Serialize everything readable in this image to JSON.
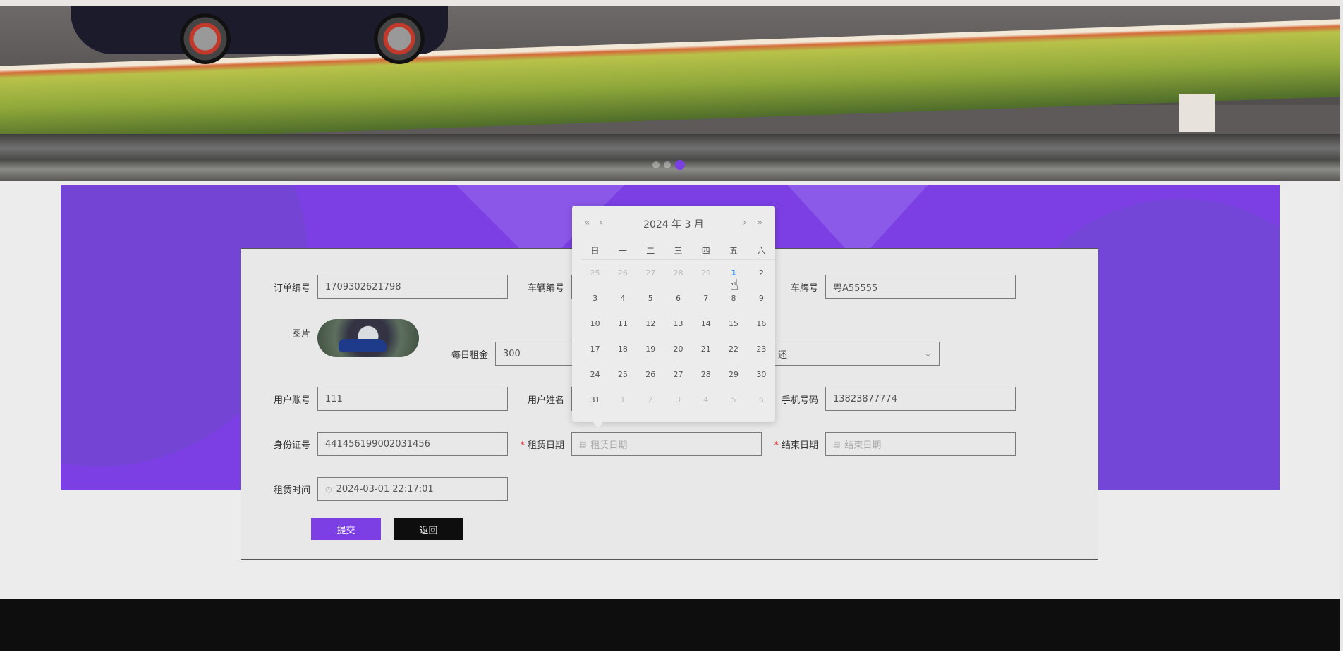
{
  "carousel": {
    "slide_count": 3,
    "active_index": 2
  },
  "form": {
    "order_no": {
      "label": "订单编号",
      "value": "1709302621798"
    },
    "vehicle_no": {
      "label": "车辆编号"
    },
    "plate": {
      "label": "车牌号",
      "value": "粤A55555"
    },
    "picture": {
      "label": "图片"
    },
    "daily_rent": {
      "label": "每日租金",
      "value": "300"
    },
    "status_select": {
      "value": "还"
    },
    "user_account": {
      "label": "用户账号",
      "value": "111"
    },
    "user_name": {
      "label": "用户姓名"
    },
    "phone": {
      "label": "手机号码",
      "value": "13823877774"
    },
    "id_card": {
      "label": "身份证号",
      "value": "441456199002031456"
    },
    "rent_date": {
      "label": "租赁日期",
      "placeholder": "租赁日期",
      "required_mark": "*"
    },
    "end_date": {
      "label": "结束日期",
      "placeholder": "结束日期",
      "required_mark": "*"
    },
    "rent_time": {
      "label": "租赁时间",
      "value": "2024-03-01 22:17:01"
    },
    "submit_label": "提交",
    "back_label": "返回"
  },
  "calendar": {
    "title": "2024 年  3 月",
    "nav": {
      "prev_year": "«",
      "prev_month": "‹",
      "next_month": "›",
      "next_year": "»"
    },
    "weekdays": [
      "日",
      "一",
      "二",
      "三",
      "四",
      "五",
      "六"
    ],
    "weeks": [
      [
        "25",
        "26",
        "27",
        "28",
        "29",
        "1",
        "2"
      ],
      [
        "3",
        "4",
        "5",
        "6",
        "7",
        "8",
        "9"
      ],
      [
        "10",
        "11",
        "12",
        "13",
        "14",
        "15",
        "16"
      ],
      [
        "17",
        "18",
        "19",
        "20",
        "21",
        "22",
        "23"
      ],
      [
        "24",
        "25",
        "26",
        "27",
        "28",
        "29",
        "30"
      ],
      [
        "31",
        "1",
        "2",
        "3",
        "4",
        "5",
        "6"
      ]
    ],
    "muted_first_row_count": 5,
    "muted_last_row_from": 1,
    "today": "1"
  },
  "colors": {
    "accent": "#7b3fe4",
    "today": "#3b82f6",
    "required": "#e53935",
    "footer": "#0f0e0e"
  },
  "icons": {
    "calendar": "calendar-icon",
    "clock": "clock-icon",
    "chevron": "chevron-down-icon",
    "cursor": "hand-pointer-icon"
  }
}
